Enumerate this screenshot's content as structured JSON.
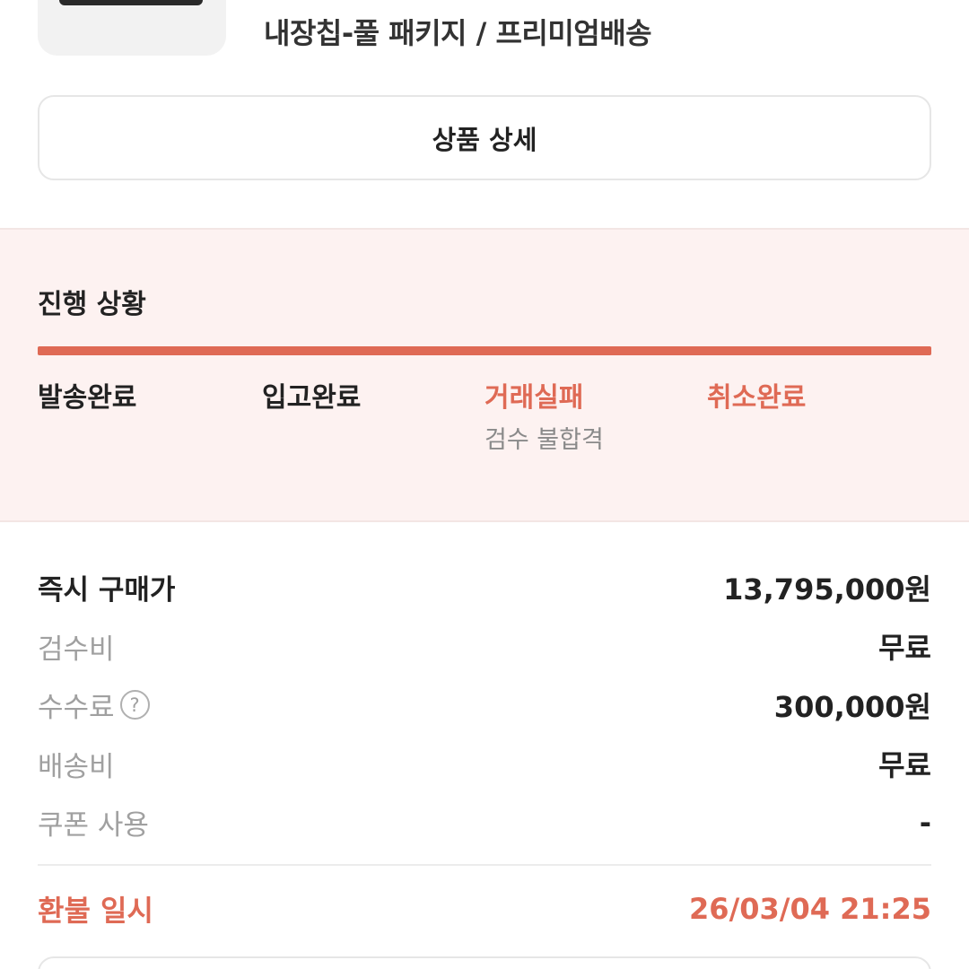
{
  "product": {
    "option_text": "내장칩-풀 패키지 / 프리미엄배송",
    "detail_button": "상품 상세"
  },
  "progress": {
    "title": "진행 상황",
    "fill_percent": 100,
    "steps": [
      {
        "label": "발송완료",
        "sub": ""
      },
      {
        "label": "입고완료",
        "sub": ""
      },
      {
        "label": "거래실패",
        "sub": "검수 불합격"
      },
      {
        "label": "취소완료",
        "sub": ""
      }
    ]
  },
  "price_rows": [
    {
      "label": "즉시 구매가",
      "value": "13,795,000원"
    },
    {
      "label": "검수비",
      "value": "무료"
    },
    {
      "label": "수수료",
      "value": "300,000원",
      "help_icon": "question-circle-icon"
    },
    {
      "label": "배송비",
      "value": "무료"
    },
    {
      "label": "쿠폰 사용",
      "value": "-"
    }
  ],
  "refund": {
    "label": "환불 일시",
    "value": "26/03/04 21:25"
  },
  "colors": {
    "accent": "#df6a55",
    "progress_bg": "#fdf2f1",
    "muted_text": "#a0a0a0"
  }
}
